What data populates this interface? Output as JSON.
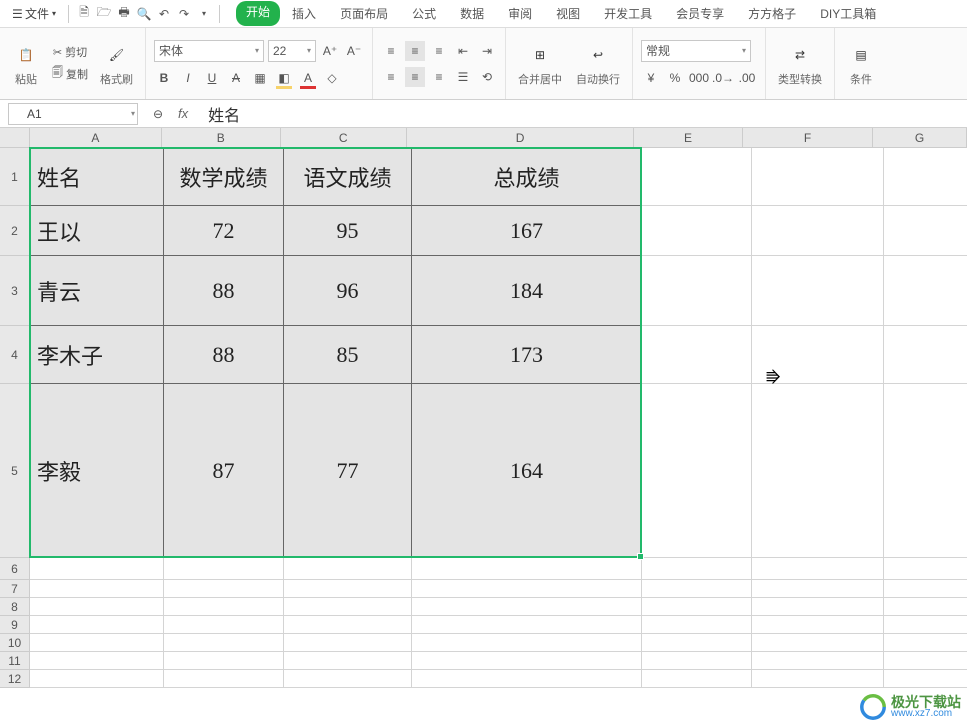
{
  "menubar": {
    "file_label": "文件",
    "qat_icons": [
      "new-doc-icon",
      "open-doc-icon",
      "print-icon",
      "print-preview-icon",
      "undo-icon",
      "redo-icon"
    ]
  },
  "tabs": [
    {
      "label": "开始",
      "active": true
    },
    {
      "label": "插入",
      "active": false
    },
    {
      "label": "页面布局",
      "active": false
    },
    {
      "label": "公式",
      "active": false
    },
    {
      "label": "数据",
      "active": false
    },
    {
      "label": "审阅",
      "active": false
    },
    {
      "label": "视图",
      "active": false
    },
    {
      "label": "开发工具",
      "active": false
    },
    {
      "label": "会员专享",
      "active": false
    },
    {
      "label": "方方格子",
      "active": false
    },
    {
      "label": "DIY工具箱",
      "active": false
    }
  ],
  "ribbon": {
    "paste_label": "粘贴",
    "cut_label": "剪切",
    "copy_label": "复制",
    "format_painter_label": "格式刷",
    "font_name": "宋体",
    "font_size": "22",
    "merge_center_label": "合并居中",
    "wrap_label": "自动换行",
    "number_format": "常规",
    "type_convert_label": "类型转换",
    "cond_format_label": "条件"
  },
  "formula_bar": {
    "name_box": "A1",
    "fx_symbol": "fx",
    "content": "姓名"
  },
  "columns": [
    "A",
    "B",
    "C",
    "D",
    "E",
    "F",
    "G"
  ],
  "chart_data": {
    "type": "table",
    "headers": [
      "姓名",
      "数学成绩",
      "语文成绩",
      "总成绩"
    ],
    "rows": [
      [
        "王以",
        "72",
        "95",
        "167"
      ],
      [
        "青云",
        "88",
        "96",
        "184"
      ],
      [
        "李木子",
        "88",
        "85",
        "173"
      ],
      [
        "李毅",
        "87",
        "77",
        "164"
      ]
    ]
  },
  "row_heights": {
    "r1": 58,
    "r2": 50,
    "r3": 70,
    "r4": 58,
    "r5": 174,
    "thin": 18
  },
  "watermark": {
    "name": "极光下载站",
    "url": "www.xz7.com"
  }
}
